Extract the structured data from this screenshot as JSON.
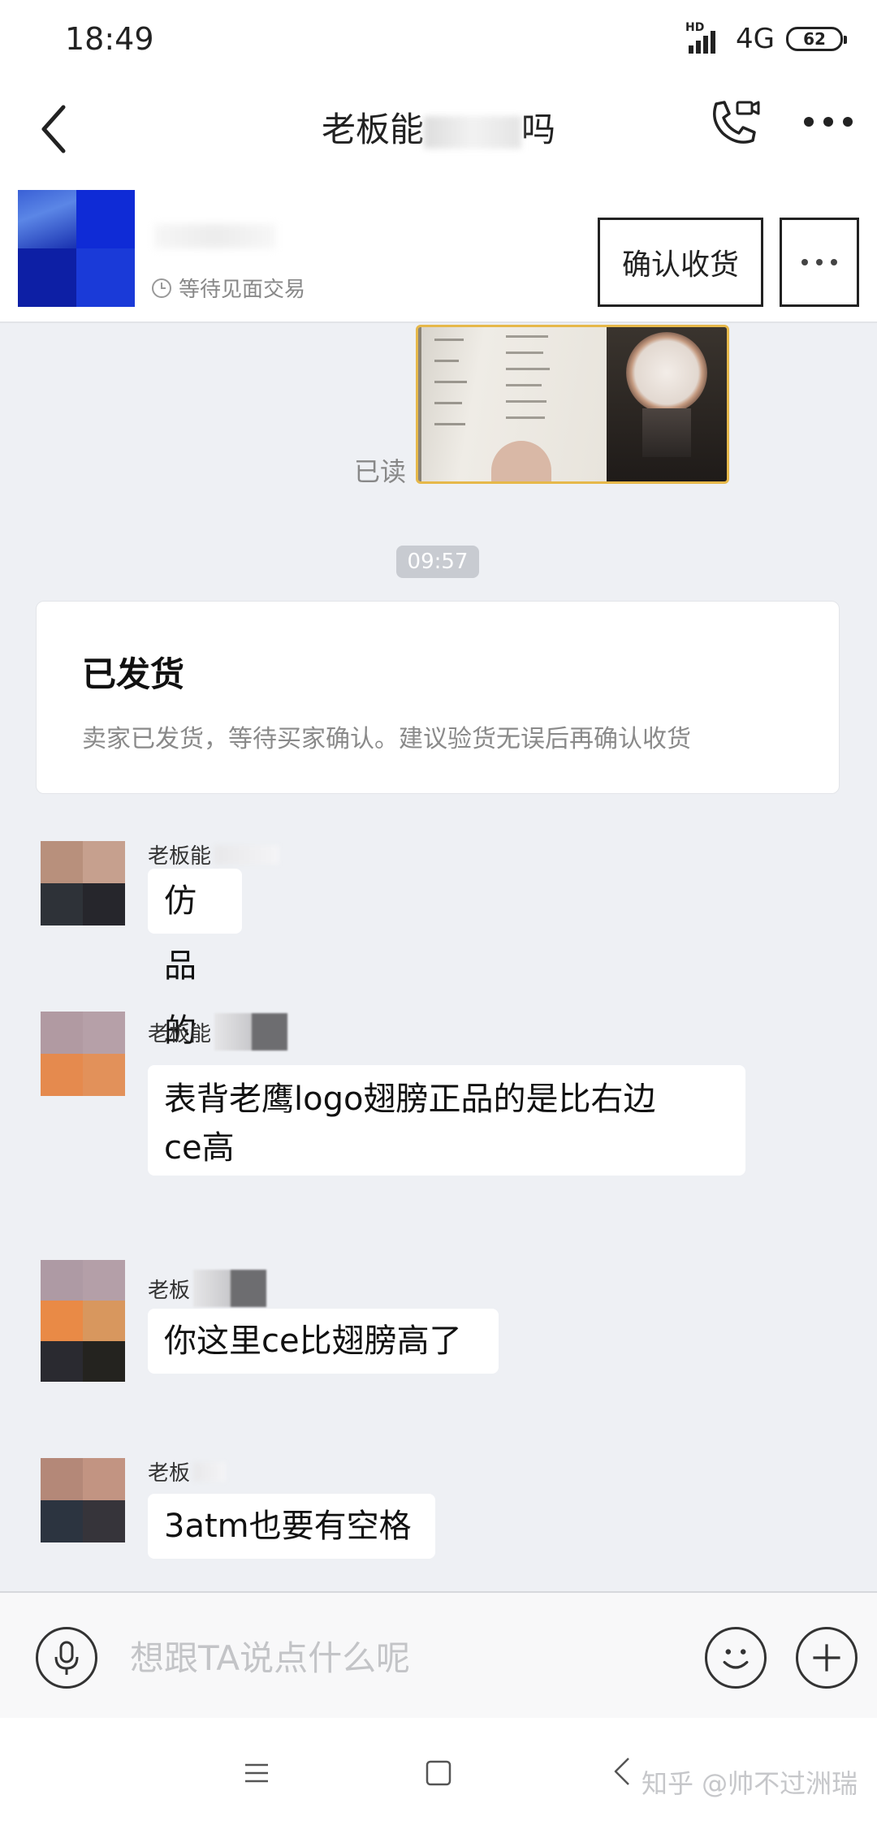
{
  "status_bar": {
    "time": "18:49",
    "hd": "HD",
    "network": "4G",
    "battery": "62"
  },
  "header": {
    "title_start": "老板能",
    "title_end": "吗"
  },
  "product": {
    "status": "等待见面交易",
    "confirm_label": "确认收货"
  },
  "chat": {
    "read_label": "已读",
    "timestamp": "09:57",
    "system_card": {
      "title": "已发货",
      "body": "卖家已发货，等待买家确认。建议验货无误后再确认收货"
    },
    "messages": [
      {
        "sender": "老板能",
        "text": "仿品的",
        "avatar": [
          "#b8907c",
          "#c6a08e",
          "#2e3238",
          "#26262c"
        ]
      },
      {
        "sender": "老板能",
        "text_line1": "表背老鹰logo翅膀正品的是比右边",
        "text_line2": "ce高",
        "avatar": [
          "#b19aa2",
          "#b6a0a8",
          "#e58a4e",
          "#e2915a"
        ]
      },
      {
        "sender": "老板",
        "text": "你这里ce比翅膀高了",
        "avatar": [
          "#ae9aa4",
          "#b49fa8",
          "#e98a46",
          "#d8975e",
          "#2a2a30",
          "#24231f"
        ]
      },
      {
        "sender": "老板",
        "text": "3atm也要有空格",
        "avatar": [
          "#b48878",
          "#c29482",
          "#2c3440",
          "#36343a"
        ]
      }
    ]
  },
  "input_bar": {
    "placeholder": "想跟TA说点什么呢"
  },
  "watermark": "知乎 @帅不过洲瑞"
}
